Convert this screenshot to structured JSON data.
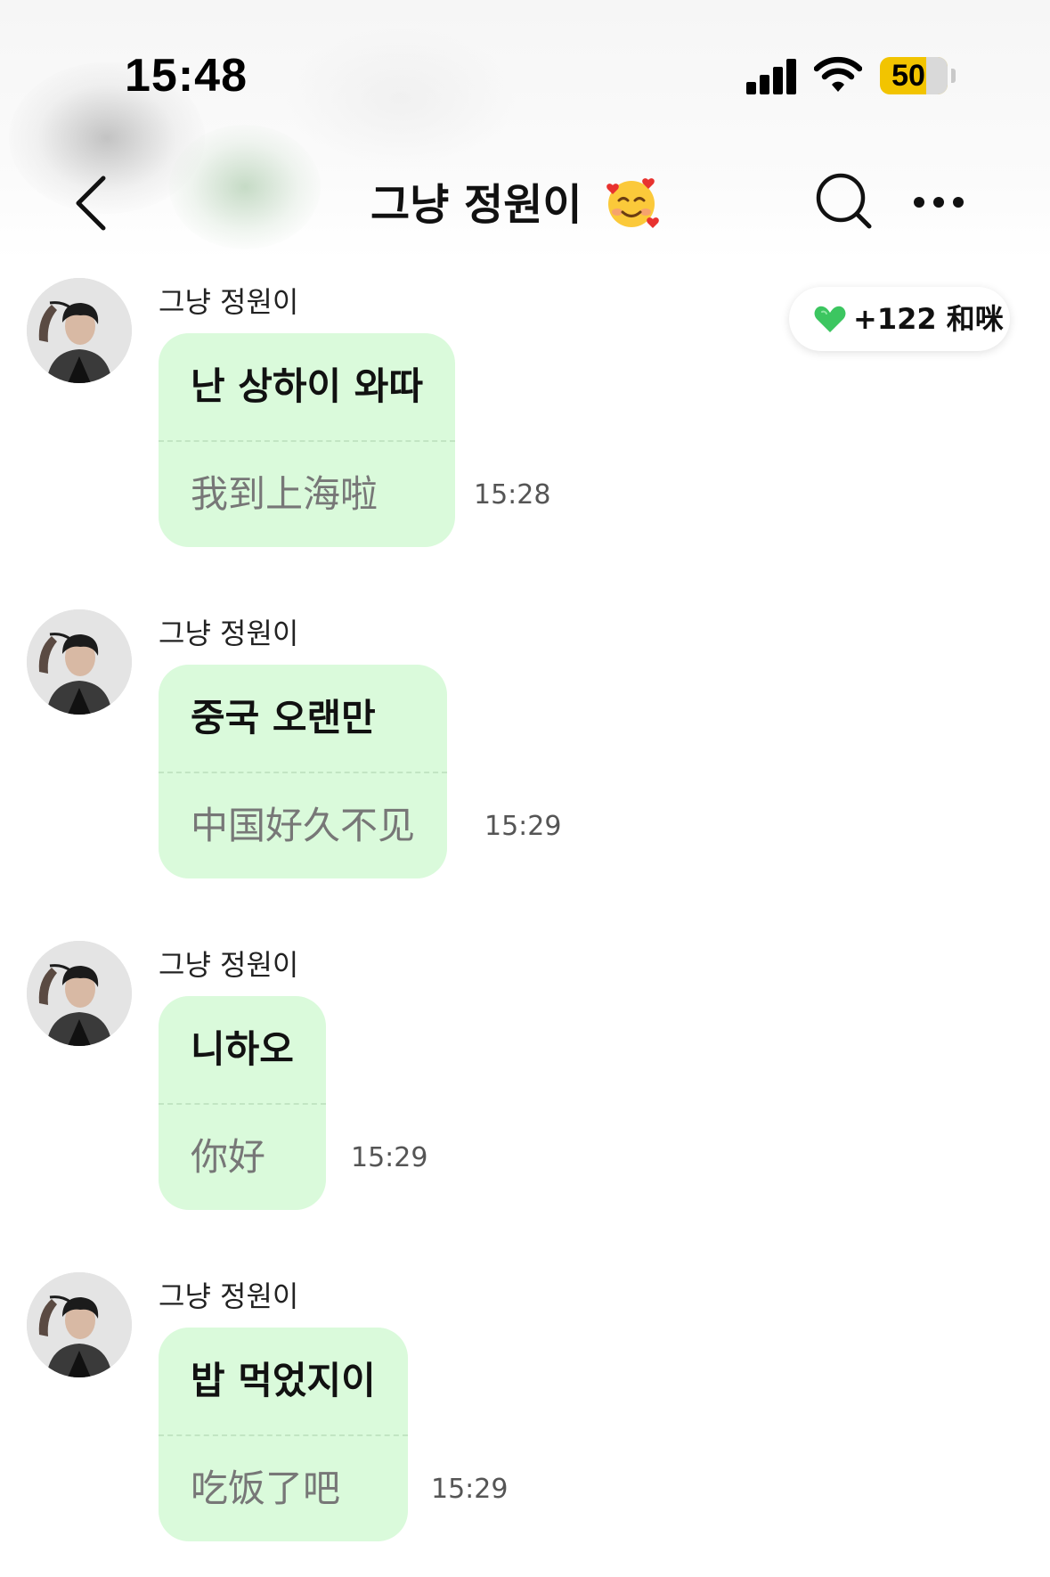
{
  "status_bar": {
    "time": "15:48",
    "battery_level": "50",
    "icons": [
      "cellular-signal-icon",
      "wifi-icon",
      "battery-icon"
    ]
  },
  "header": {
    "title": "그냥 정원이",
    "title_emoji_icon": "smiling-face-with-hearts-icon",
    "back_icon": "chevron-left-icon",
    "search_icon": "search-icon",
    "more_icon": "more-horizontal-icon"
  },
  "points_badge": {
    "icon": "green-heart-icon",
    "text": "+122 和咪"
  },
  "colors": {
    "bubble_bg": "#dafadb",
    "pill_heart": "#3cc660",
    "battery": "#f2c400"
  },
  "messages": [
    {
      "sender": "그냥 정원이",
      "original": "난 상하이 와따",
      "translation": "我到上海啦",
      "time": "15:28"
    },
    {
      "sender": "그냥 정원이",
      "original": "중국 오랜만",
      "translation": "中国好久不见",
      "time": "15:29"
    },
    {
      "sender": "그냥 정원이",
      "original": "니하오",
      "translation": "你好",
      "time": "15:29"
    },
    {
      "sender": "그냥 정원이",
      "original": "밥 먹었지이",
      "translation": "吃饭了吧",
      "time": "15:29"
    }
  ]
}
